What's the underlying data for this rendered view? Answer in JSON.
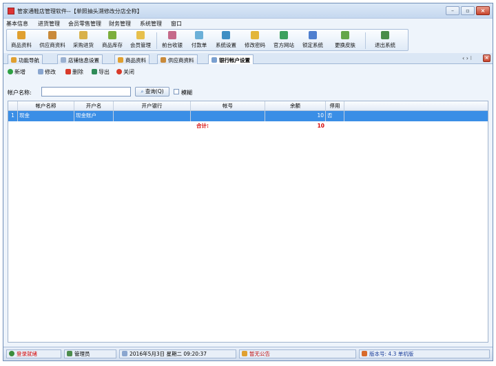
{
  "window": {
    "title": "管家通鞋店管理软件--【单照抽头溯修改分店全称】"
  },
  "menu": [
    "基本信息",
    "进货管理",
    "会员零售管理",
    "财务管理",
    "系统管理",
    "窗口"
  ],
  "toolbar": [
    {
      "label": "商品资料",
      "icon": "product-icon",
      "color": "#e0a030"
    },
    {
      "label": "供应商资料",
      "icon": "supplier-icon",
      "color": "#c98a3a"
    },
    {
      "label": "采购进货",
      "icon": "purchase-icon",
      "color": "#d8b14a"
    },
    {
      "label": "商品库存",
      "icon": "stock-icon",
      "color": "#7cae3c"
    },
    {
      "label": "会员管理",
      "icon": "member-icon",
      "color": "#e7c04c"
    },
    {
      "label": "前台收银",
      "icon": "cashier-icon",
      "color": "#c56a8a"
    },
    {
      "label": "付款单",
      "icon": "payment-icon",
      "color": "#6bb0d8"
    },
    {
      "label": "系统设置",
      "icon": "settings-icon",
      "color": "#3f8fc4"
    },
    {
      "label": "修改密码",
      "icon": "key-icon",
      "color": "#e3b63a"
    },
    {
      "label": "官方网站",
      "icon": "globe-icon",
      "color": "#3ca15e"
    },
    {
      "label": "锁定系统",
      "icon": "lock-icon",
      "color": "#4f7fcf"
    },
    {
      "label": "更换皮肤",
      "icon": "skin-icon",
      "color": "#64a64a"
    },
    {
      "label": "退出系统",
      "icon": "exit-icon",
      "color": "#4a8c4a"
    }
  ],
  "tabs": [
    {
      "label": "功能导航",
      "color": "#e0a030",
      "active": false
    },
    {
      "label": "店铺信息设置",
      "color": "#9ab0d0",
      "active": false
    },
    {
      "label": "商品资料",
      "color": "#e0a030",
      "active": false
    },
    {
      "label": "供应商资料",
      "color": "#c98a3a",
      "active": false
    },
    {
      "label": "银行帐户设置",
      "color": "#7aa0d0",
      "active": true
    }
  ],
  "tab_controls": "‹ › ⁝",
  "actions": [
    {
      "label": "新增",
      "icon": "add-icon",
      "color": "#2ea043"
    },
    {
      "label": "修改",
      "icon": "edit-icon",
      "color": "#8aa6cf"
    },
    {
      "label": "删除",
      "icon": "delete-icon",
      "color": "#d83a2a"
    },
    {
      "label": "导出",
      "icon": "export-icon",
      "color": "#2e8b57"
    },
    {
      "label": "关闭",
      "icon": "close-icon",
      "color": "#d83a2a"
    }
  ],
  "search": {
    "label": "帐户名称:",
    "value": "",
    "button": "查询(Q)",
    "fuzzy_label": "模糊"
  },
  "grid": {
    "columns": [
      "帐户名称",
      "开户名",
      "开户银行",
      "帐号",
      "余额",
      "停用"
    ],
    "rows": [
      {
        "rownum": "1",
        "cells": [
          "现金",
          "现金账户",
          "",
          "",
          "10",
          "否"
        ]
      }
    ],
    "sum_label": "合计:",
    "sum_value": "10"
  },
  "status": {
    "state": "登录就绪",
    "user": "管理员",
    "datetime": "2016年5月3日  星期二  09:20:37",
    "notice": "暂无公告",
    "version": "版本号: 4.3 单机版"
  }
}
